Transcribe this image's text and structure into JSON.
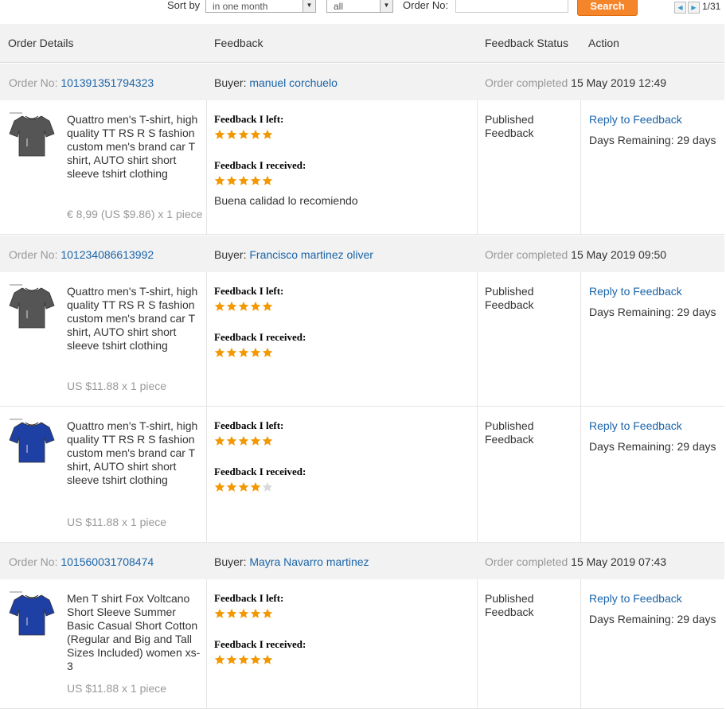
{
  "toolbar": {
    "sort_label": "Sort by",
    "sort_value": "in one month",
    "filter_value": "all",
    "order_no_label": "Order No:",
    "order_no_value": "",
    "search_label": "Search",
    "pager": "1/31"
  },
  "table_header": {
    "order_details": "Order Details",
    "feedback": "Feedback",
    "feedback_status": "Feedback Status",
    "action": "Action"
  },
  "colors": {
    "accent": "#f5852b",
    "link": "#1b64a8",
    "star": "#f39800",
    "star_empty": "#d9d9d9"
  },
  "labels": {
    "order_no": "Order No:",
    "buyer": "Buyer:",
    "order_completed": "Order completed",
    "feedback_left": "Feedback I left:",
    "feedback_received": "Feedback I received:",
    "published": "Published Feedback",
    "reply": "Reply to Feedback",
    "days_remaining": "Days Remaining: 29 days"
  },
  "orders": [
    {
      "order_no": "101391351794323",
      "buyer": "manuel corchuelo",
      "completed": "15 May 2019 12:49",
      "items": [
        {
          "title": "Quattro men's T-shirt, high quality TT RS R S fashion custom men's brand car T shirt, AUTO shirt short sleeve tshirt clothing",
          "price": "€ 8,99 (US $9.86) x 1 piece",
          "shirt_color": "#555555",
          "left_rating": 5,
          "received_rating": 5,
          "comment": "Buena calidad lo recomiendo"
        }
      ]
    },
    {
      "order_no": "101234086613992",
      "buyer": "Francisco martinez oliver",
      "completed": "15 May 2019 09:50",
      "items": [
        {
          "title": "Quattro men's T-shirt, high quality TT RS R S fashion custom men's brand car T shirt, AUTO shirt short sleeve tshirt clothing",
          "price": "US $11.88 x 1 piece",
          "shirt_color": "#555555",
          "left_rating": 5,
          "received_rating": 5,
          "comment": ""
        },
        {
          "title": "Quattro men's T-shirt, high quality TT RS R S fashion custom men's brand car T shirt, AUTO shirt short sleeve tshirt clothing",
          "price": "US $11.88 x 1 piece",
          "shirt_color": "#1e3fa3",
          "left_rating": 5,
          "received_rating": 4,
          "comment": ""
        }
      ]
    },
    {
      "order_no": "101560031708474",
      "buyer": "Mayra Navarro martinez",
      "completed": "15 May 2019 07:43",
      "items": [
        {
          "title": "Men T shirt Fox Voltcano Short Sleeve Summer Basic Casual Short Cotton (Regular and Big and Tall Sizes Included) women xs-3",
          "price": "US $11.88 x 1 piece",
          "shirt_color": "#1e3fa3",
          "left_rating": 5,
          "received_rating": 5,
          "comment": ""
        }
      ]
    }
  ]
}
